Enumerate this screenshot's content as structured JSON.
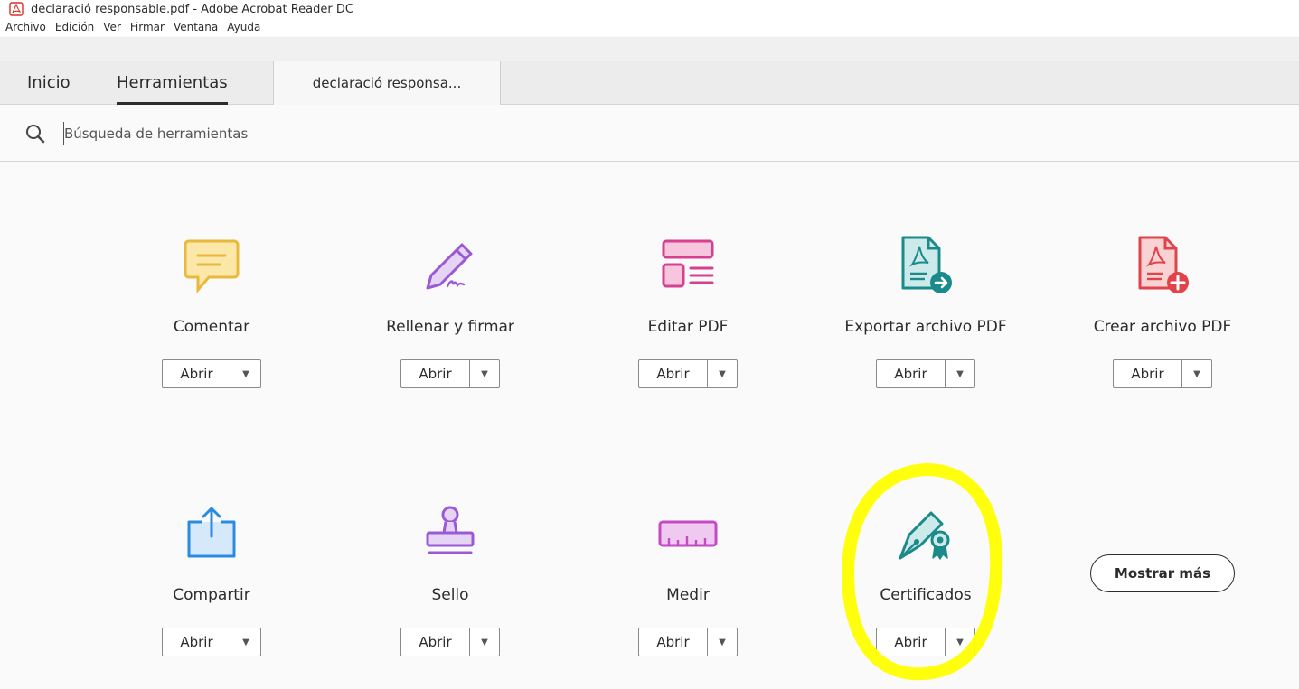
{
  "window": {
    "title": "declaració responsable.pdf - Adobe Acrobat Reader DC"
  },
  "menu": [
    "Archivo",
    "Edición",
    "Ver",
    "Firmar",
    "Ventana",
    "Ayuda"
  ],
  "tabs": {
    "home": "Inicio",
    "tools": "Herramientas",
    "document": "declaració responsa..."
  },
  "search": {
    "placeholder": "Búsqueda de herramientas"
  },
  "tools": [
    {
      "label": "Comentar",
      "open": "Abrir",
      "icon": "comment-icon",
      "color": "#e8b93a"
    },
    {
      "label": "Rellenar y firmar",
      "open": "Abrir",
      "icon": "fill-sign-icon",
      "color": "#9b59d6"
    },
    {
      "label": "Editar PDF",
      "open": "Abrir",
      "icon": "edit-pdf-icon",
      "color": "#d6408e"
    },
    {
      "label": "Exportar archivo PDF",
      "open": "Abrir",
      "icon": "export-pdf-icon",
      "color": "#1b8a8a"
    },
    {
      "label": "Crear archivo PDF",
      "open": "Abrir",
      "icon": "create-pdf-icon",
      "color": "#e0434a"
    },
    {
      "label": "Compartir",
      "open": "Abrir",
      "icon": "share-icon",
      "color": "#2b8be0"
    },
    {
      "label": "Sello",
      "open": "Abrir",
      "icon": "stamp-icon",
      "color": "#9b59d6"
    },
    {
      "label": "Medir",
      "open": "Abrir",
      "icon": "measure-icon",
      "color": "#c44bc4"
    },
    {
      "label": "Certificados",
      "open": "Abrir",
      "icon": "certificates-icon",
      "color": "#1b8a8a"
    }
  ],
  "show_more": "Mostrar más",
  "annotation": {
    "color": "#ffff00"
  }
}
